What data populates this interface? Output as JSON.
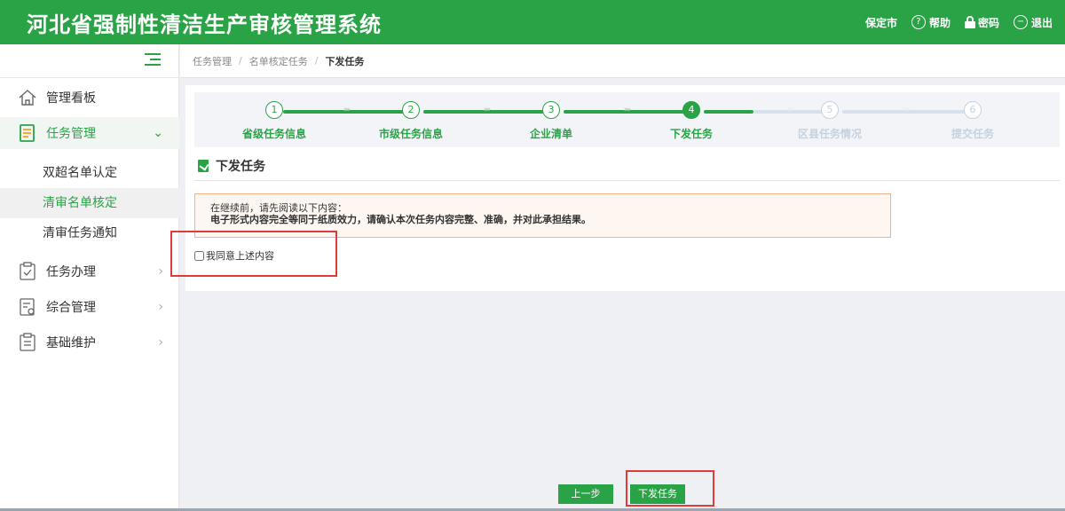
{
  "header": {
    "title": "河北省强制性清洁生产审核管理系统",
    "city": "保定市",
    "help_label": "帮助",
    "password_label": "密码",
    "logout_label": "退出",
    "brand_color": "#2aa347"
  },
  "breadcrumb": {
    "items": [
      "任务管理",
      "名单核定任务",
      "下发任务"
    ]
  },
  "sidebar": {
    "menu": [
      {
        "label": "管理看板",
        "icon": "home-icon"
      },
      {
        "label": "任务管理",
        "icon": "task-list-icon",
        "expanded": true
      },
      {
        "label": "任务办理",
        "icon": "clipboard-check-icon"
      },
      {
        "label": "综合管理",
        "icon": "document-settings-icon"
      },
      {
        "label": "基础维护",
        "icon": "clipboard-icon"
      }
    ],
    "submenu": [
      "双超名单认定",
      "清审名单核定",
      "清审任务通知"
    ],
    "active_submenu": "清审名单核定"
  },
  "steps": [
    {
      "num": "1",
      "label": "省级任务信息",
      "state": "done"
    },
    {
      "num": "2",
      "label": "市级任务信息",
      "state": "done"
    },
    {
      "num": "3",
      "label": "企业清单",
      "state": "done"
    },
    {
      "num": "4",
      "label": "下发任务",
      "state": "current"
    },
    {
      "num": "5",
      "label": "区县任务情况",
      "state": "pending"
    },
    {
      "num": "6",
      "label": "提交任务",
      "state": "pending"
    }
  ],
  "section": {
    "title": "下发任务"
  },
  "notice": {
    "line1": "在继续前，请先阅读以下内容：",
    "line2": "电子形式内容完全等同于纸质效力，请确认本次任务内容完整、准确，并对此承担结果。"
  },
  "agree": {
    "label": "我同意上述内容",
    "checked": false
  },
  "actions": {
    "prev_label": "上一步",
    "submit_label": "下发任务"
  }
}
